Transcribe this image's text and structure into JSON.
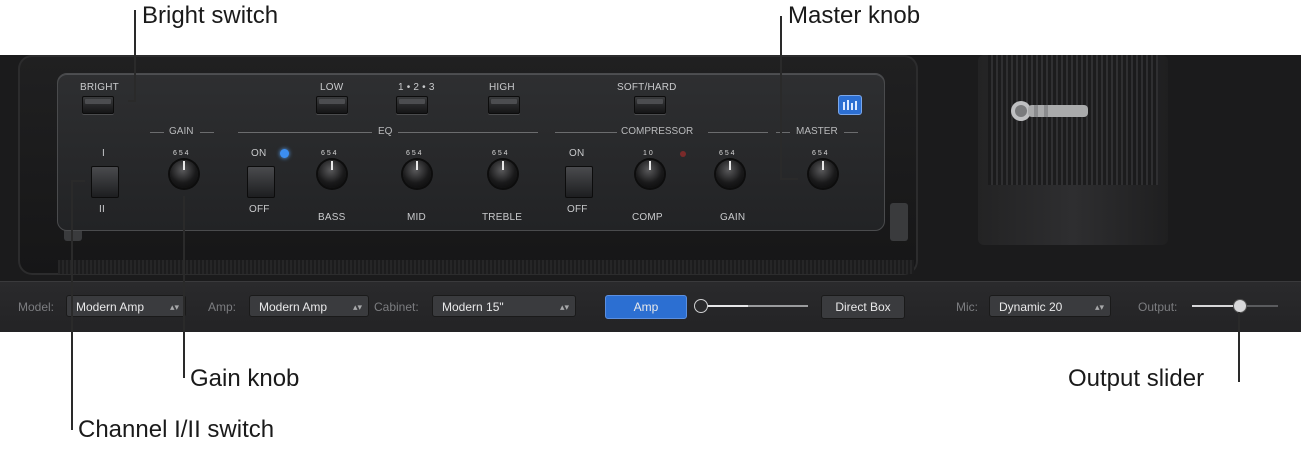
{
  "callouts": {
    "bright_switch": "Bright switch",
    "master_knob": "Master knob",
    "gain_knob": "Gain knob",
    "channel_switch": "Channel I/II switch",
    "output_slider": "Output slider"
  },
  "amp": {
    "switch_labels": {
      "bright": "BRIGHT",
      "low": "LOW",
      "mode": "1 • 2 • 3",
      "high": "HIGH",
      "soft_hard": "SOFT/HARD"
    },
    "sections": {
      "gain": "GAIN",
      "eq": "EQ",
      "compressor": "COMPRESSOR",
      "master": "MASTER"
    },
    "channel": {
      "top": "I",
      "bottom": "II"
    },
    "eq_switch": {
      "on": "ON",
      "off": "OFF"
    },
    "comp_switch": {
      "on": "ON",
      "off": "OFF"
    },
    "knob_labels": {
      "bass": "BASS",
      "mid": "MID",
      "treble": "TREBLE",
      "comp": "COMP",
      "comp_gain": "GAIN"
    },
    "knob_scale": "6 5 4",
    "comp_scale": "1 0",
    "eq_button_icon": "eq-bars-icon"
  },
  "bottom_bar": {
    "model_label": "Model:",
    "model_value": "Modern Amp",
    "amp_label": "Amp:",
    "amp_value": "Modern Amp",
    "cabinet_label": "Cabinet:",
    "cabinet_value": "Modern 15\"",
    "amp_button": "Amp",
    "direct_box_button": "Direct Box",
    "blend_level": 0.45,
    "mic_label": "Mic:",
    "mic_value": "Dynamic 20",
    "output_label": "Output:",
    "output_level": 0.55
  },
  "colors": {
    "accent": "#2c6fd2",
    "panel": "#1b1b1c"
  }
}
